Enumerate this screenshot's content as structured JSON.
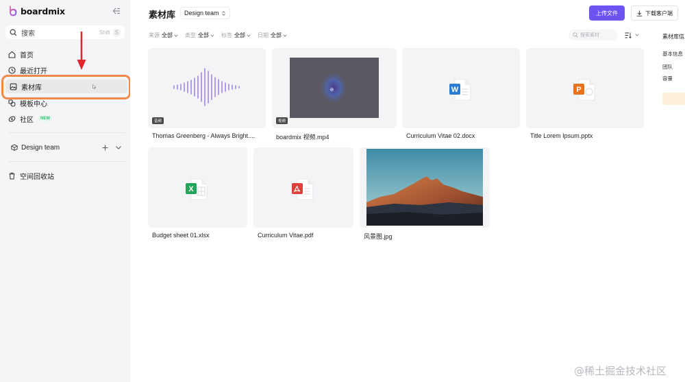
{
  "brand": {
    "name": "boardmix"
  },
  "sidebar": {
    "search": {
      "label": "搜索",
      "shortcut": "Shift",
      "shortcut_key": "S"
    },
    "items": [
      {
        "label": "首页",
        "icon": "home-icon"
      },
      {
        "label": "最近打开",
        "icon": "clock-icon"
      },
      {
        "label": "素材库",
        "icon": "asset-library-icon"
      },
      {
        "label": "模板中心",
        "icon": "template-icon"
      },
      {
        "label": "社区",
        "icon": "community-icon",
        "badge": "NEW"
      }
    ],
    "team": {
      "label": "Design team"
    },
    "trash": {
      "label": "空间回收站"
    }
  },
  "header": {
    "title": "素材库",
    "team_selector": "Design team",
    "upload_label": "上传文件",
    "download_label": "下载客户端"
  },
  "filters": [
    {
      "label": "来源",
      "value": "全部"
    },
    {
      "label": "类型",
      "value": "全部"
    },
    {
      "label": "标签",
      "value": "全部"
    },
    {
      "label": "日期",
      "value": "全部"
    }
  ],
  "asset_search": {
    "placeholder": "搜索素材"
  },
  "assets": [
    {
      "name": "Thomas Greenberg - Always Bright....",
      "type": "audio",
      "badge": "音频"
    },
    {
      "name": "boardmix 视频.mp4",
      "type": "video",
      "badge": "视频"
    },
    {
      "name": "Curriculum Vitae 02.docx",
      "type": "word",
      "icon_letter": "W"
    },
    {
      "name": "Title Lorem Ipsum.pptx",
      "type": "powerpoint",
      "icon_letter": "P"
    },
    {
      "name": "Budget sheet 01.xlsx",
      "type": "excel",
      "icon_letter": "X"
    },
    {
      "name": "Curriculum Vitae.pdf",
      "type": "pdf"
    },
    {
      "name": "风景图.jpg",
      "type": "image"
    }
  ],
  "info_panel": {
    "title": "素材库信息",
    "rows": [
      "基本信息",
      "团队",
      "容量"
    ]
  },
  "watermark": "@稀土掘金技术社区",
  "colors": {
    "accent": "#6f52f2",
    "highlight": "#f08a4b",
    "arrow": "#e0262b",
    "audio_wave": "#9b7fe6",
    "word": "#2b7cd3",
    "powerpoint": "#e8731e",
    "excel": "#23a55a",
    "pdf": "#e0403a"
  }
}
